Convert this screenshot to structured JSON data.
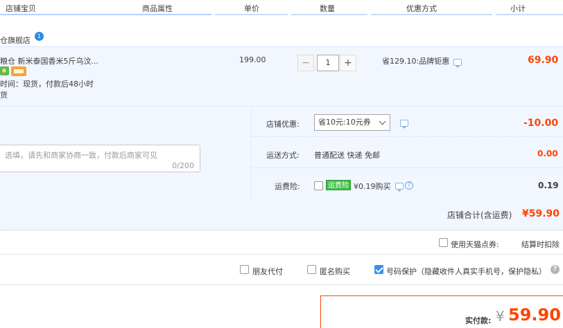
{
  "columns": {
    "shop_item": "店铺宝贝",
    "attributes": "商品属性",
    "unit_price": "单价",
    "quantity": "数量",
    "discount": "优惠方式",
    "subtotal": "小计"
  },
  "shop": {
    "name": "仓旗舰店",
    "badge": "1"
  },
  "item": {
    "title": "粮仓 新米泰国香米5斤乌汶...",
    "shipping_time": "时间：现货，付款后48小时",
    "shipping_extra": "货",
    "unit_price": "199.00",
    "quantity": "1",
    "decrement_symbol": "−",
    "increment_symbol": "+",
    "discount_text": "省129.10:品牌钜惠",
    "subtotal": "69.90"
  },
  "services": {
    "note_placeholder": "选填，请先和商家协商一致，付款后商家可见",
    "note_counter": "0/200",
    "shop_discount_label": "店铺优惠:",
    "coupon_selected": "省10元:10元券",
    "shop_discount_value": "-10.00",
    "delivery_label": "运送方式:",
    "delivery_value": "普通配送 快递 免邮",
    "delivery_fee": "0.00",
    "insurance_label": "运费险:",
    "insurance_tag": "运费险",
    "insurance_text": "¥0.19购买",
    "insurance_help": "?",
    "insurance_fee": "0.19"
  },
  "shop_total": {
    "label": "店铺合计(含运费)",
    "value": "¥59.90"
  },
  "points": {
    "label": "使用天猫点券:",
    "note": "结算时扣除"
  },
  "options": {
    "friend_pay": "朋友代付",
    "anonymous": "匿名购买",
    "number_protect": "号码保护（隐藏收件人真实手机号，保护隐私）",
    "number_protect_checked": true,
    "help": "?"
  },
  "payment": {
    "label": "实付款:",
    "currency": "¥",
    "amount": "59.90"
  },
  "colors": {
    "accent_red": "#ff4400",
    "accent_blue": "#3b8ef0",
    "band_blue": "#f2f7ff"
  }
}
